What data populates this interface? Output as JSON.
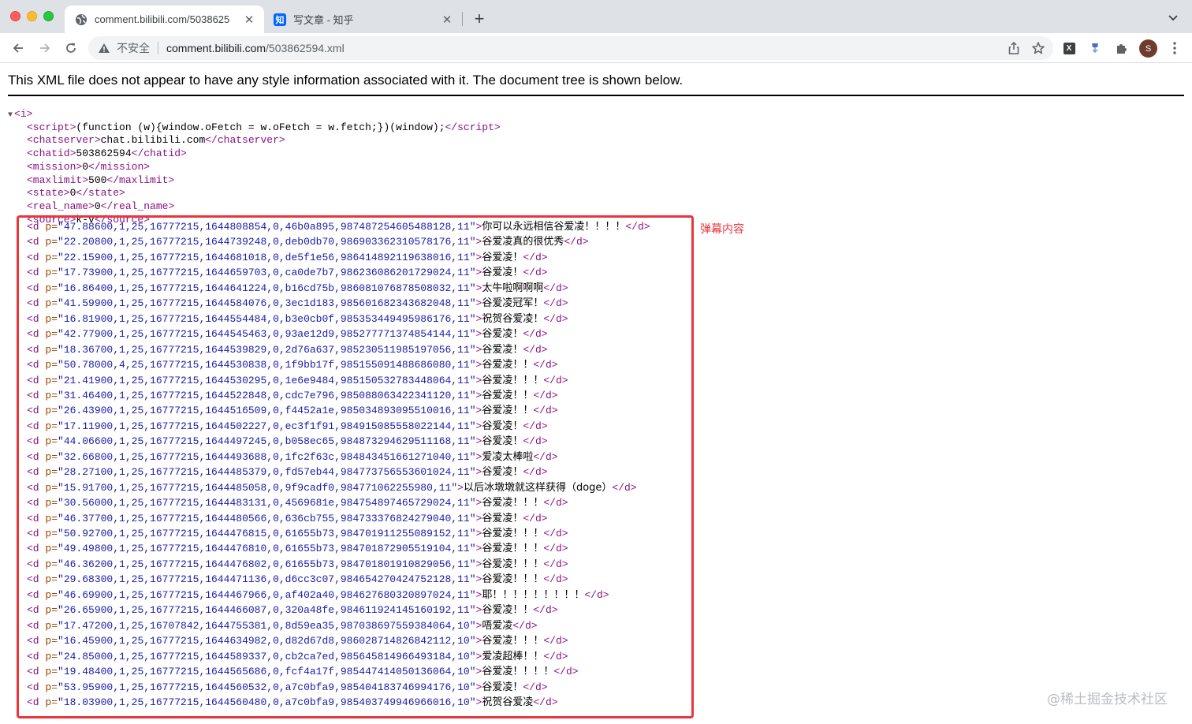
{
  "browser": {
    "tabs": [
      {
        "title": "comment.bilibili.com/5038625",
        "active": true,
        "favicon": "globe-icon"
      },
      {
        "title": "写文章 - 知乎",
        "active": false,
        "favicon": "zhihu-icon",
        "favicon_text": "知"
      }
    ],
    "omnibox": {
      "security_label": "不安全",
      "url_host": "comment.bilibili.com",
      "url_path": "/503862594.xml"
    },
    "profile_initial": "S",
    "colors": {
      "tabstrip": "#dee1e6",
      "highlight": "#e8363f"
    }
  },
  "page": {
    "notice": "This XML file does not appear to have any style information associated with it. The document tree is shown below.",
    "root_open": "<i>",
    "header_lines": [
      {
        "tag": "script",
        "text": "(function (w){window.oFetch = w.oFetch = w.fetch;})(window);"
      },
      {
        "tag": "chatserver",
        "text": "chat.bilibili.com"
      },
      {
        "tag": "chatid",
        "text": "503862594"
      },
      {
        "tag": "mission",
        "text": "0"
      },
      {
        "tag": "maxlimit",
        "text": "500"
      },
      {
        "tag": "state",
        "text": "0"
      },
      {
        "tag": "real_name",
        "text": "0"
      },
      {
        "tag": "source",
        "text": "k-v"
      }
    ],
    "danmaku": [
      {
        "p": "47.88600,1,25,16777215,1644808854,0,46b0a895,987487254605488128,11",
        "text": "你可以永远相信谷爱凌！！！！"
      },
      {
        "p": "22.20800,1,25,16777215,1644739248,0,deb0db70,986903362310578176,11",
        "text": "谷爱凌真的很优秀"
      },
      {
        "p": "22.15900,1,25,16777215,1644681018,0,de5f1e56,986414892119638016,11",
        "text": "谷爱凌！"
      },
      {
        "p": "17.73900,1,25,16777215,1644659703,0,ca0de7b7,986236086201729024,11",
        "text": "谷爱凌！"
      },
      {
        "p": "16.86400,1,25,16777215,1644641224,0,b16cd75b,986081076878508032,11",
        "text": "太牛啦啊啊啊"
      },
      {
        "p": "41.59900,1,25,16777215,1644584076,0,3ec1d183,985601682343682048,11",
        "text": "谷爱凌冠军！"
      },
      {
        "p": "16.81900,1,25,16777215,1644554484,0,b3e0cb0f,985353449495986176,11",
        "text": "祝贺谷爱凌！"
      },
      {
        "p": "42.77900,1,25,16777215,1644545463,0,93ae12d9,985277771374854144,11",
        "text": "谷爱凌！"
      },
      {
        "p": "18.36700,1,25,16777215,1644539829,0,2d76a637,985230511985197056,11",
        "text": "谷爱凌！"
      },
      {
        "p": "50.78000,4,25,16777215,1644530838,0,1f9bb17f,985155091488686080,11",
        "text": "谷爱凌！！"
      },
      {
        "p": "21.41900,1,25,16777215,1644530295,0,1e6e9484,985150532783448064,11",
        "text": "谷爱凌！！！"
      },
      {
        "p": "31.46400,1,25,16777215,1644522848,0,cdc7e796,985088063422341120,11",
        "text": "谷爱凌！！"
      },
      {
        "p": "26.43900,1,25,16777215,1644516509,0,f4452a1e,985034893095510016,11",
        "text": "谷爱凌！！"
      },
      {
        "p": "17.11900,1,25,16777215,1644502227,0,ec3f1f91,984915085558022144,11",
        "text": "谷爱凌！"
      },
      {
        "p": "44.06600,1,25,16777215,1644497245,0,b058ec65,984873294629511168,11",
        "text": "谷爱凌！"
      },
      {
        "p": "32.66800,1,25,16777215,1644493688,0,1fc2f63c,984843451661271040,11",
        "text": "爱凌太棒啦"
      },
      {
        "p": "28.27100,1,25,16777215,1644485379,0,fd57eb44,984773756553601024,11",
        "text": "谷爱凌！"
      },
      {
        "p": "15.91700,1,25,16777215,1644485058,0,9f9cadf0,984771062255980,11",
        "text": "以后冰墩墩就这样获得（doge）"
      },
      {
        "p": "30.56000,1,25,16777215,1644483131,0,4569681e,984754897465729024,11",
        "text": "谷爱凌！！！"
      },
      {
        "p": "46.37700,1,25,16777215,1644480566,0,636cb755,984733376824279040,11",
        "text": "谷爱凌！"
      },
      {
        "p": "50.92700,1,25,16777215,1644476815,0,61655b73,984701911255089152,11",
        "text": "谷爱凌！！！"
      },
      {
        "p": "49.49800,1,25,16777215,1644476810,0,61655b73,984701872905519104,11",
        "text": "谷爱凌！！！"
      },
      {
        "p": "46.36200,1,25,16777215,1644476802,0,61655b73,984701801910829056,11",
        "text": "谷爱凌！！！"
      },
      {
        "p": "29.68300,1,25,16777215,1644471136,0,d6cc3c07,984654270424752128,11",
        "text": "谷爱凌！！！"
      },
      {
        "p": "46.69900,1,25,16777215,1644467966,0,af402a40,984627680320897024,11",
        "text": "耶！！！！！！！！！"
      },
      {
        "p": "26.65900,1,25,16777215,1644466087,0,320a48fe,984611924145160192,11",
        "text": "谷爱凌！！"
      },
      {
        "p": "17.47200,1,25,16707842,1644755381,0,8d59ea35,987038697559384064,10",
        "text": "唔爱凌"
      },
      {
        "p": "16.45900,1,25,16777215,1644634982,0,d82d67d8,986028714826842112,10",
        "text": "谷爱凌！！！"
      },
      {
        "p": "24.85000,1,25,16777215,1644589337,0,cb2ca7ed,985645814966493184,10",
        "text": "爱凌超棒！！"
      },
      {
        "p": "19.48400,1,25,16777215,1644565686,0,fcf4a17f,985447414050136064,10",
        "text": "谷爱凌！！！！"
      },
      {
        "p": "53.95900,1,25,16777215,1644560532,0,a7c0bfa9,985404183746994176,10",
        "text": "谷爱凌！"
      },
      {
        "p": "18.03900,1,25,16777215,1644560480,0,a7c0bfa9,985403749946966016,10",
        "text": "祝贺谷爱凌"
      }
    ],
    "annotation": "弹幕内容",
    "watermark": "@稀土掘金技术社区"
  }
}
